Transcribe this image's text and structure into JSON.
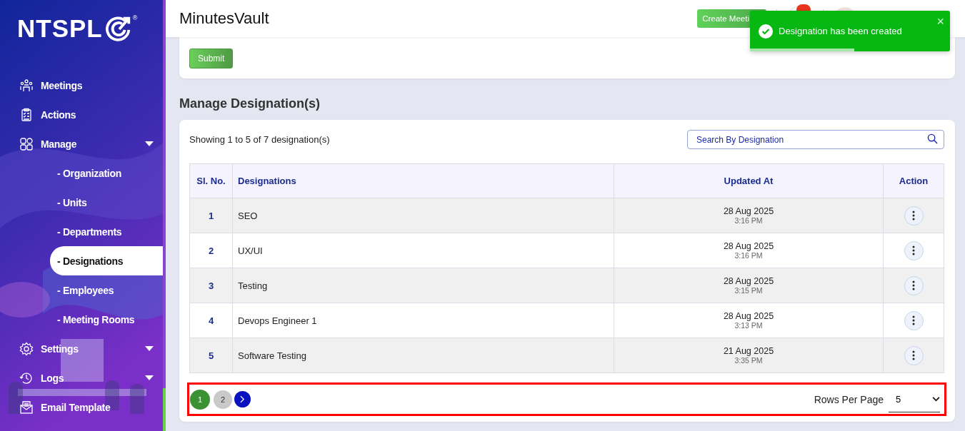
{
  "sidebar": {
    "logo": "NTSPL",
    "logo_mark": "®",
    "items": [
      {
        "kind": "main",
        "label": "Meetings",
        "selected": false,
        "caret": false
      },
      {
        "kind": "main",
        "label": "Actions",
        "selected": false,
        "caret": false
      },
      {
        "kind": "main",
        "label": "Manage",
        "selected": false,
        "caret": true
      },
      {
        "kind": "sub",
        "label": "- Organization",
        "selected": false
      },
      {
        "kind": "sub",
        "label": "- Units",
        "selected": false
      },
      {
        "kind": "sub",
        "label": "- Departments",
        "selected": false
      },
      {
        "kind": "sub",
        "label": "- Designations",
        "selected": true
      },
      {
        "kind": "sub",
        "label": "- Employees",
        "selected": false
      },
      {
        "kind": "sub",
        "label": "- Meeting Rooms",
        "selected": false
      },
      {
        "kind": "main",
        "label": "Settings",
        "selected": false,
        "caret": true
      },
      {
        "kind": "main",
        "label": "Logs",
        "selected": false,
        "caret": true
      },
      {
        "kind": "main",
        "label": "Email Template",
        "selected": false,
        "caret": false
      }
    ]
  },
  "header": {
    "title": "MinutesVault",
    "create_button": "Create Meeti"
  },
  "toast": {
    "message": "Designation has been created",
    "close": "×",
    "level": 0.52
  },
  "form": {
    "submit": "Submit"
  },
  "section_title": "Manage Designation(s)",
  "summary": "Showing 1 to 5 of 7 designation(s)",
  "search": {
    "placeholder": "Search By Designation"
  },
  "table": {
    "columns": [
      "Sl. No.",
      "Designations",
      "Updated At",
      "Action"
    ],
    "rows": [
      {
        "sl": "1",
        "designation": "SEO",
        "date": "28 Aug 2025",
        "time": "3:16 PM"
      },
      {
        "sl": "2",
        "designation": "UX/UI",
        "date": "28 Aug 2025",
        "time": "3:16 PM"
      },
      {
        "sl": "3",
        "designation": "Testing",
        "date": "28 Aug 2025",
        "time": "3:15 PM"
      },
      {
        "sl": "4",
        "designation": "Devops Engineer 1",
        "date": "28 Aug 2025",
        "time": "3:13 PM"
      },
      {
        "sl": "5",
        "designation": "Software Testing",
        "date": "21 Aug 2025",
        "time": "3:35 PM"
      }
    ]
  },
  "pagination": {
    "pages": [
      {
        "label": "1",
        "selected": true
      },
      {
        "label": "2",
        "selected": false
      }
    ],
    "rows_per_page_label": "Rows Per Page",
    "rows_per_page": "5"
  }
}
